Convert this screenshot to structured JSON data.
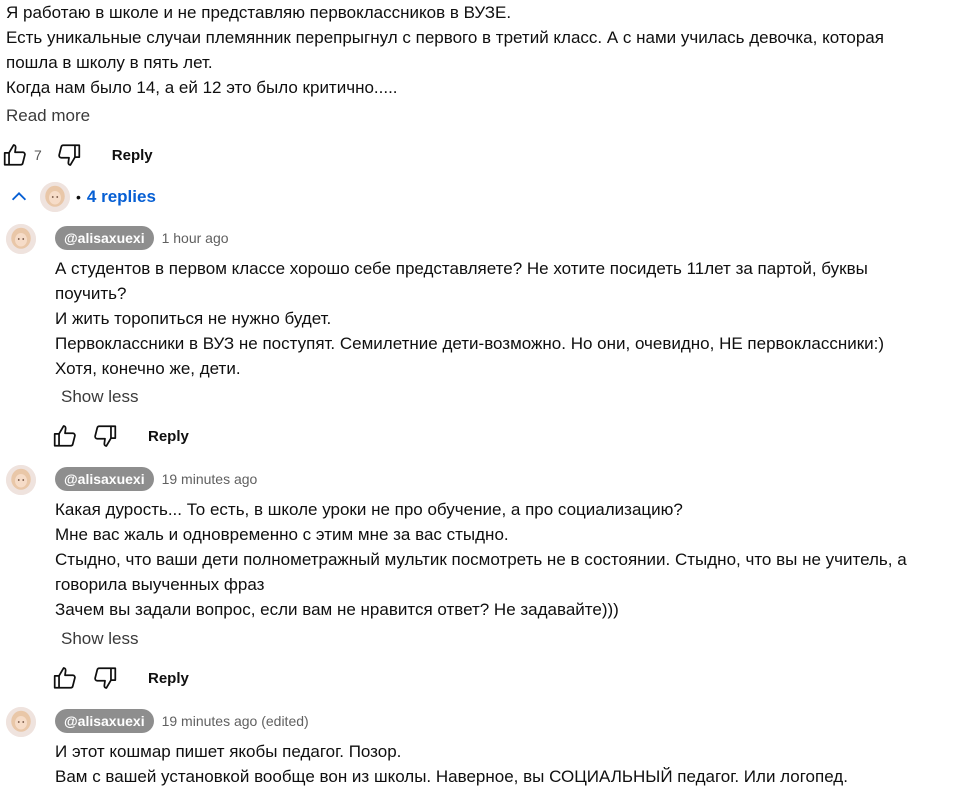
{
  "parent": {
    "lines": [
      "Я работаю в школе и не представляю первоклассников в ВУЗЕ.",
      "Есть уникальные случаи племянник перепрыгнул с первого в третий класс. А с нами училась девочка, которая",
      "пошла в школу в пять лет.",
      "Когда нам было 14, а ей 12 это было критично....."
    ],
    "read_more": "Read more",
    "like_count": "7",
    "reply_label": "Reply"
  },
  "replies_toggle": {
    "dot": "•",
    "label": "4 replies"
  },
  "replies": [
    {
      "handle": "@alisaxuexi",
      "time": "1 hour ago",
      "lines": [
        "А студентов в первом классе хорошо себе представляете? Не хотите посидеть 11лет за партой, буквы",
        "поучить?",
        "И жить торопиться не нужно будет.",
        "Первоклассники в ВУЗ не поступят. Семилетние дети-возможно. Но они, очевидно, НЕ первоклассники:)",
        "Хотя, конечно же, дети."
      ],
      "show_less": "Show less",
      "reply_label": "Reply"
    },
    {
      "handle": "@alisaxuexi",
      "time": "19 minutes ago",
      "lines": [
        "Какая дурость... То есть, в школе уроки не про обучение, а про социализацию?",
        "Мне вас жаль и одновременно с этим мне за вас стыдно.",
        "Стыдно, что ваши дети полнометражный мультик посмотреть не в состоянии. Стыдно, что вы не учитель, а",
        "говорила выученных фраз",
        "Зачем вы задали вопрос, если вам не нравится ответ? Не задавайте)))"
      ],
      "show_less": "Show less",
      "reply_label": "Reply"
    },
    {
      "handle": "@alisaxuexi",
      "time": "19 minutes ago (edited)",
      "lines": [
        "И этот кошмар пишет якобы педагог. Позор.",
        "Вам с вашей установкой вообще вон из школы. Наверное, вы СОЦИАЛЬНЫЙ педагог. Или логопед."
      ]
    }
  ],
  "icons": {
    "like": "thumb-up-icon",
    "dislike": "thumb-down-icon",
    "collapse": "chevron-up-icon"
  },
  "colors": {
    "link_blue": "#065fd4",
    "handle_bg": "#8e8e8e",
    "meta_gray": "#606060"
  }
}
